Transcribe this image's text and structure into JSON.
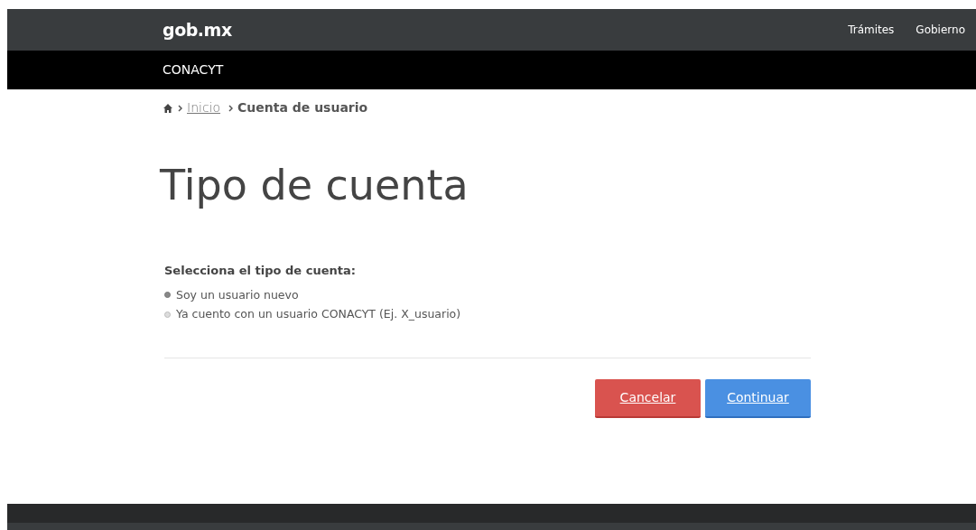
{
  "header": {
    "logo": "gob.mx",
    "links": [
      "Trámites",
      "Gobierno"
    ]
  },
  "subheader": {
    "title": "CONACYT"
  },
  "breadcrumb": {
    "link": "Inicio",
    "current": "Cuenta de usuario"
  },
  "page_title": "Tipo de cuenta",
  "form": {
    "label": "Selecciona el tipo de cuenta:",
    "options": [
      {
        "label": "Soy un usuario nuevo",
        "selected": true
      },
      {
        "label": "Ya cuento con un usuario CONACYT (Ej. X_usuario)",
        "selected": false
      }
    ]
  },
  "buttons": [
    {
      "label": "Cancelar",
      "kind": "cancel"
    },
    {
      "label": "Continuar",
      "kind": "primary"
    }
  ]
}
